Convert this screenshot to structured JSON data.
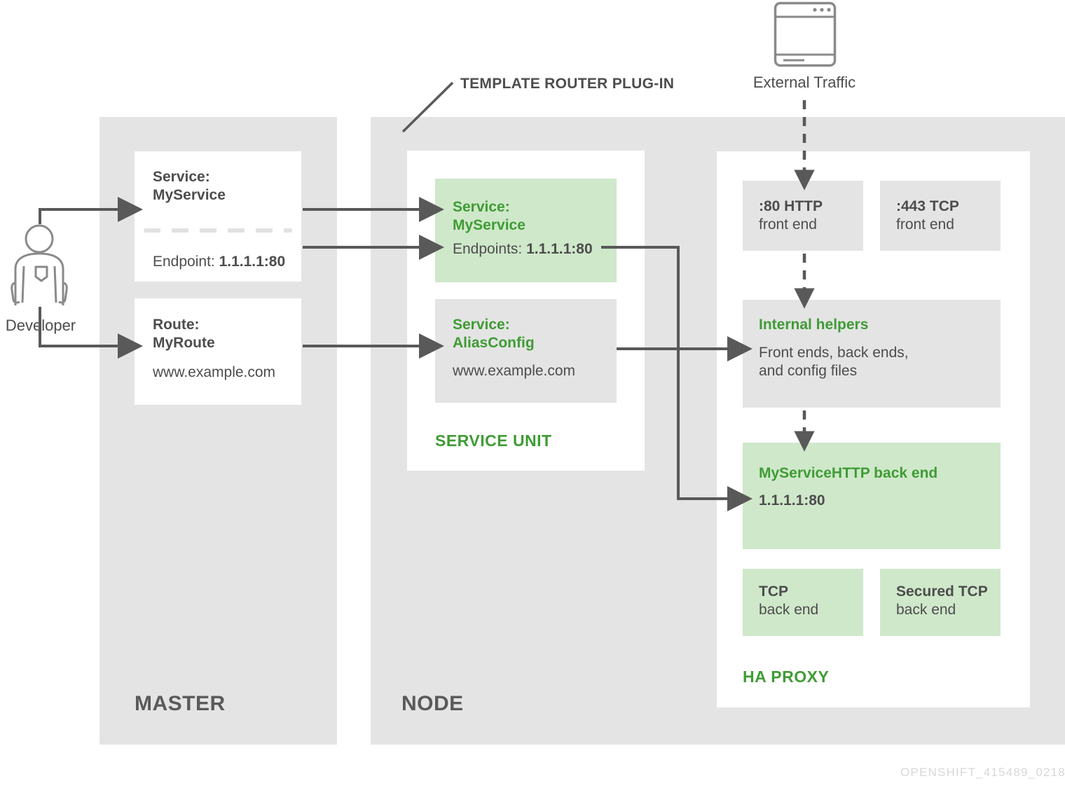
{
  "diagram": {
    "watermark": "OPENSHIFT_415489_0218",
    "colors": {
      "panel_gray": "#e4e4e4",
      "box_green": "#cfe8ca",
      "text_green": "#3f9c35",
      "text_dark": "#4d4d4d",
      "arrow": "#595959",
      "white": "#ffffff"
    }
  },
  "actor": {
    "label": "Developer",
    "icon": "person-icon"
  },
  "external": {
    "label": "External Traffic",
    "icon": "browser-window-icon"
  },
  "annotations": {
    "plugin_label": "TEMPLATE ROUTER PLUG-IN"
  },
  "master": {
    "panel_label": "MASTER",
    "service_box": {
      "title_line1": "Service:",
      "title_line2": "MyService",
      "endpoint": "Endpoint: 1.1.1.1:80",
      "endpoint_prefix": "Endpoint: ",
      "endpoint_value": "1.1.1.1:80"
    },
    "route_box": {
      "title_line1": "Route:",
      "title_line2": "MyRoute",
      "host": "www.example.com"
    }
  },
  "node": {
    "panel_label": "NODE",
    "service_unit": {
      "group_label": "SERVICE UNIT",
      "service_box": {
        "title_line1": "Service:",
        "title_line2": "MyService",
        "endpoints_prefix": "Endpoints: ",
        "endpoints_value": "1.1.1.1:80"
      },
      "alias_box": {
        "title_line1": "Service:",
        "title_line2": "AliasConfig",
        "host": "www.example.com"
      }
    },
    "haproxy": {
      "group_label": "HA PROXY",
      "frontends": [
        {
          "title": ":80 HTTP",
          "subtitle": "front end"
        },
        {
          "title": ":443 TCP",
          "subtitle": "front end"
        }
      ],
      "helpers": {
        "title": "Internal helpers",
        "line1": "Front ends, back ends,",
        "line2": "and config files"
      },
      "http_backend": {
        "title": "MyServiceHTTP back end",
        "address": "1.1.1.1:80"
      },
      "backends": [
        {
          "title": "TCP",
          "subtitle": "back end"
        },
        {
          "title": "Secured TCP",
          "subtitle": "back end"
        }
      ]
    }
  }
}
